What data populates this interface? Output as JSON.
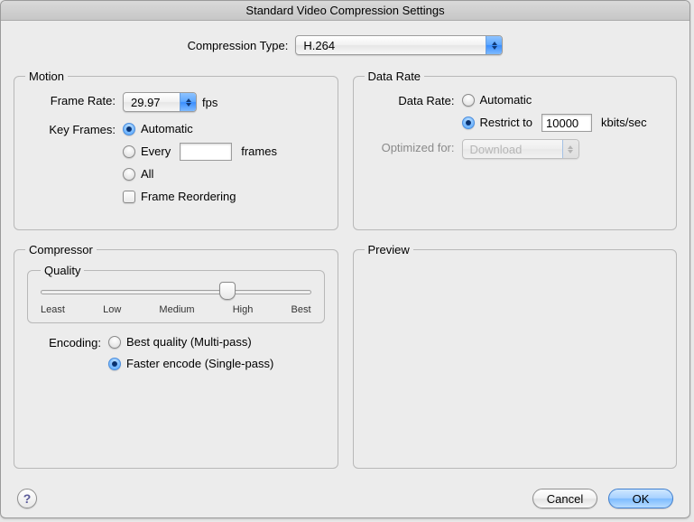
{
  "window": {
    "title": "Standard Video Compression Settings"
  },
  "compression": {
    "label": "Compression Type:",
    "value": "H.264"
  },
  "motion": {
    "legend": "Motion",
    "frame_rate_label": "Frame Rate:",
    "frame_rate_value": "29.97",
    "frame_rate_unit": "fps",
    "key_frames_label": "Key Frames:",
    "kf_automatic": "Automatic",
    "kf_every": "Every",
    "kf_every_value": "",
    "kf_every_unit": "frames",
    "kf_all": "All",
    "frame_reordering": "Frame Reordering"
  },
  "datarate": {
    "legend": "Data Rate",
    "label": "Data Rate:",
    "automatic": "Automatic",
    "restrict": "Restrict to",
    "restrict_value": "10000",
    "restrict_unit": "kbits/sec",
    "optimized_label": "Optimized for:",
    "optimized_value": "Download"
  },
  "compressor": {
    "legend": "Compressor",
    "quality_legend": "Quality",
    "ticks": [
      "Least",
      "Low",
      "Medium",
      "High",
      "Best"
    ],
    "slider_percent": 69,
    "encoding_label": "Encoding:",
    "best_quality": "Best quality (Multi-pass)",
    "faster_encode": "Faster encode (Single-pass)"
  },
  "preview": {
    "legend": "Preview"
  },
  "footer": {
    "help": "?",
    "cancel": "Cancel",
    "ok": "OK"
  }
}
